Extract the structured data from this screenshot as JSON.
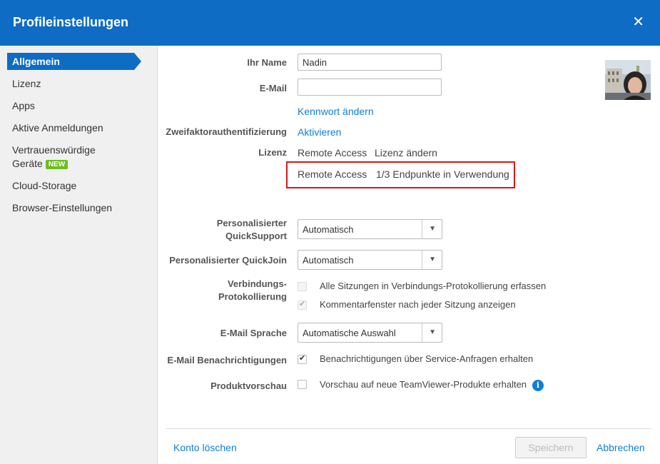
{
  "window": {
    "title": "Profileinstellungen",
    "close_glyph": "✕"
  },
  "sidebar": {
    "items": [
      {
        "label": "Allgemein"
      },
      {
        "label": "Lizenz"
      },
      {
        "label": "Apps"
      },
      {
        "label": "Aktive Anmeldungen"
      },
      {
        "label": "Vertrauenswürdige",
        "label2": "Geräte",
        "badge": "NEW"
      },
      {
        "label": "Cloud-Storage"
      },
      {
        "label": "Browser-Einstellungen"
      }
    ]
  },
  "form": {
    "name_label": "Ihr Name",
    "name_value": "Nadin",
    "email_label": "E-Mail",
    "email_value": "",
    "change_password": "Kennwort ändern",
    "twofa_label": "Zweifaktorauthentifizierung",
    "twofa_action": "Aktivieren",
    "license_label": "Lizenz",
    "license_value": "Remote Access",
    "license_change": "Lizenz ändern",
    "license_usage_product": "Remote Access",
    "license_usage": "1/3 Endpunkte in Verwendung",
    "quicksupport_label_1": "Personalisierter",
    "quicksupport_label_2": "QuickSupport",
    "quicksupport_value": "Automatisch",
    "quickjoin_label": "Personalisierter QuickJoin",
    "quickjoin_value": "Automatisch",
    "connlog_label_1": "Verbindungs-",
    "connlog_label_2": "Protokollierung",
    "connlog_all_sessions": "Alle Sitzungen in Verbindungs-Protokollierung erfassen",
    "connlog_comment_window": "Kommentarfenster nach jeder Sitzung anzeigen",
    "email_lang_label": "E-Mail Sprache",
    "email_lang_value": "Automatische Auswahl",
    "email_notif_label": "E-Mail Benachrichtigungen",
    "email_notif_text": "Benachrichtigungen über Service-Anfragen erhalten",
    "preview_label": "Produktvorschau",
    "preview_text": "Vorschau auf neue TeamViewer-Produkte erhalten",
    "info_glyph": "i",
    "tick_glyph": "✔",
    "arrow_glyph": "▼"
  },
  "checkboxes": {
    "all_sessions": false,
    "comment_window": true,
    "email_notifications": true,
    "product_preview": false
  },
  "footer": {
    "delete_account": "Konto löschen",
    "save": "Speichern",
    "cancel": "Abbrechen"
  },
  "colors": {
    "header_bg": "#0e6cc4",
    "link": "#0e7fd6",
    "highlight_border": "#d9161a",
    "badge_bg": "#6bbf1c"
  }
}
